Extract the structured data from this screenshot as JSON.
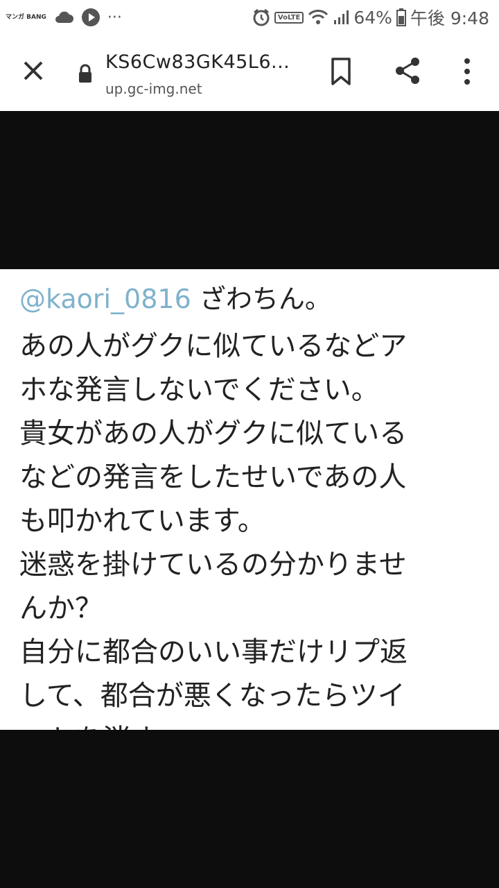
{
  "status_bar": {
    "app_badge": "マンガ BANG",
    "more": "···",
    "volte": "VoLTE",
    "battery": "64%",
    "time": "午後 9:48"
  },
  "toolbar": {
    "title": "KS6Cw83GK45L6...",
    "host": "up.gc-img.net"
  },
  "tweet": {
    "mention": "@kaori_0816",
    "mention_rest": " ざわちん。",
    "lines": [
      "あの人がグクに似ているなどア",
      "ホな発言しないでください。",
      "貴女があの人がグクに似ている",
      "などの発言をしたせいであの人",
      "も叩かれています。",
      "迷惑を掛けているの分かりませ",
      "んか？",
      "自分に都合のいい事だけリプ返",
      "して、都合が悪くなったらツイ",
      "ートを消す。"
    ]
  }
}
